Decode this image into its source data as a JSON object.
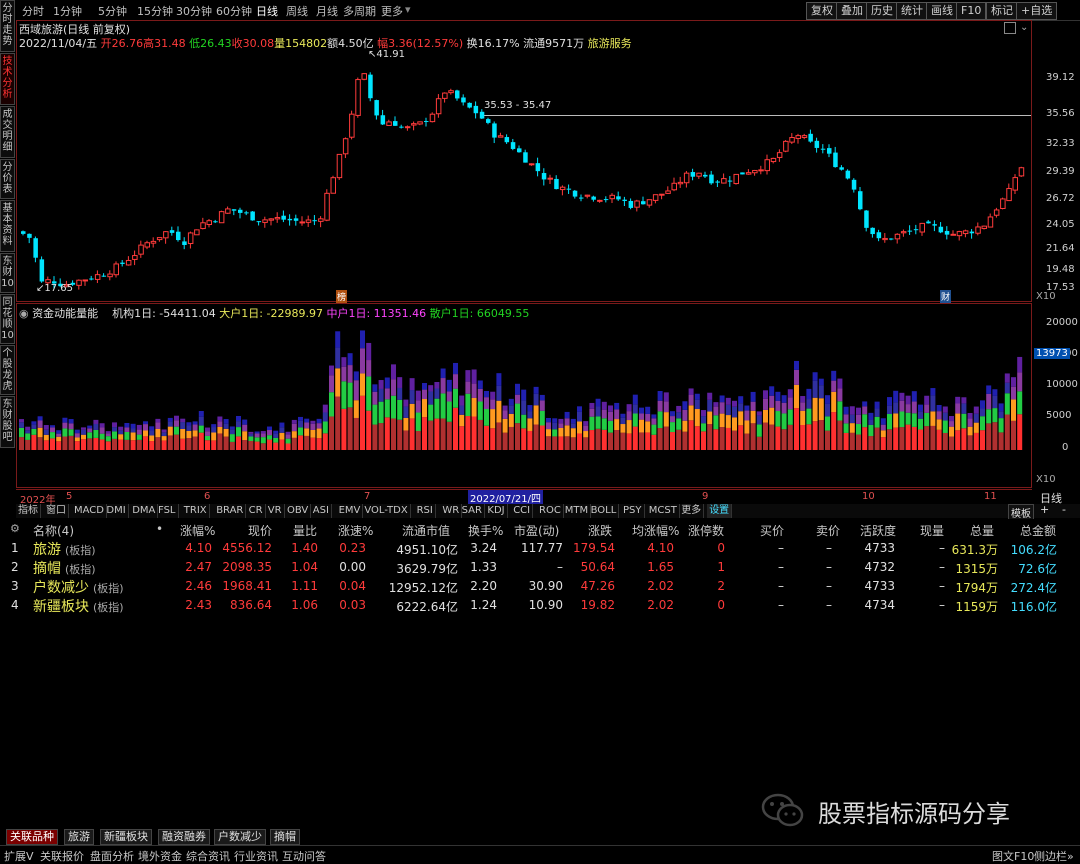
{
  "toolbar": {
    "periods": [
      "分时",
      "1分钟",
      "5分钟",
      "15分钟",
      "30分钟",
      "60分钟",
      "日线",
      "周线",
      "月线",
      "多周期",
      "更多"
    ],
    "active_period": "日线",
    "right_buttons": [
      "复权",
      "叠加",
      "历史",
      "统计",
      "画线",
      "F10",
      "标记",
      "+自选"
    ]
  },
  "left_tabs": [
    "分时走势",
    "技术分析",
    "成交明细",
    "分价表",
    "基本资料",
    "东财10",
    "同花顺10",
    "个股龙虎",
    "东财股吧"
  ],
  "active_left_tab": "技术分析",
  "stock_header": {
    "title": "西域旅游(日线 前复权)",
    "date": "2022/11/04/五",
    "open": "开26.76",
    "high": "高31.48",
    "low": "低26.43",
    "close": "收30.08",
    "volume": "量154802",
    "amount": "额4.50亿",
    "change": "幅3.36(12.57%)",
    "turnover": "换16.17%",
    "float_shares": "流通9571万",
    "industry": "旅游服务"
  },
  "main_chart": {
    "price_labels": [
      "39.12",
      "35.56",
      "32.33",
      "29.39",
      "26.72",
      "24.05",
      "21.64",
      "19.48",
      "17.53"
    ],
    "high_marker": "41.91",
    "low_marker": "17.65",
    "range_label": "35.53 - 35.47",
    "x10_label": "X10",
    "event_label_1": "榜",
    "event_label_2": "财"
  },
  "vol_chart": {
    "title": "资金动能量能",
    "metrics": [
      {
        "label": "机构1日: -54411.04",
        "color": "#e0e0e0"
      },
      {
        "label": "大户1日: -22989.97",
        "color": "#e8e85a"
      },
      {
        "label": "中户1日: 11351.46",
        "color": "#ff44ff"
      },
      {
        "label": "散户1日: 66049.55",
        "color": "#22d322"
      }
    ],
    "axis_labels": [
      "20000",
      "15000",
      "10000",
      "5000",
      "0"
    ],
    "current_value": "13973",
    "x10_label": "X10"
  },
  "date_strip": {
    "labels": [
      "2022年",
      "5",
      "6",
      "7",
      "2022/07/21/四",
      "9",
      "10",
      "11"
    ],
    "right_label": "日线"
  },
  "indicator_tabs": [
    "指标",
    "窗口",
    "MACD",
    "DMI",
    "DMA",
    "FSL",
    "TRIX",
    "BRAR",
    "CR",
    "VR",
    "OBV",
    "ASI",
    "EMV",
    "VOL-TDX",
    "RSI",
    "WR",
    "SAR",
    "KDJ",
    "CCI",
    "ROC",
    "MTM",
    "BOLL",
    "PSY",
    "MCST",
    "更多",
    "设置"
  ],
  "template_button": "模板",
  "table": {
    "headers": [
      "名称(4)",
      "•",
      "涨幅%",
      "现价",
      "量比",
      "涨速%",
      "流通市值",
      "换手%",
      "市盈(动)",
      "涨跌",
      "均涨幅%",
      "涨停数",
      "买价",
      "卖价",
      "活跃度",
      "现量",
      "总量",
      "总金额"
    ],
    "rows": [
      {
        "idx": "1",
        "name": "旅游",
        "tag": "(板指)",
        "chg": "4.10",
        "price": "4556.12",
        "vr": "1.40",
        "spd": "0.23",
        "mcap": "4951.10亿",
        "turn": "3.24",
        "pe": "117.77",
        "diff": "179.54",
        "avg": "4.10",
        "lim": "0",
        "bid": "–",
        "ask": "–",
        "act": "4733",
        "cur": "–",
        "vol": "631.3万",
        "amt": "106.2亿"
      },
      {
        "idx": "2",
        "name": "摘帽",
        "tag": "(板指)",
        "chg": "2.47",
        "price": "2098.35",
        "vr": "1.04",
        "spd": "0.00",
        "mcap": "3629.79亿",
        "turn": "1.33",
        "pe": "–",
        "diff": "50.64",
        "avg": "1.65",
        "lim": "1",
        "bid": "–",
        "ask": "–",
        "act": "4732",
        "cur": "–",
        "vol": "1315万",
        "amt": "72.6亿"
      },
      {
        "idx": "3",
        "name": "户数减少",
        "tag": "(板指)",
        "chg": "2.46",
        "price": "1968.41",
        "vr": "1.11",
        "spd": "0.04",
        "mcap": "12952.12亿",
        "turn": "2.20",
        "pe": "30.90",
        "diff": "47.26",
        "avg": "2.02",
        "lim": "2",
        "bid": "–",
        "ask": "–",
        "act": "4733",
        "cur": "–",
        "vol": "1794万",
        "amt": "272.4亿"
      },
      {
        "idx": "4",
        "name": "新疆板块",
        "tag": "(板指)",
        "chg": "2.43",
        "price": "836.64",
        "vr": "1.06",
        "spd": "0.03",
        "mcap": "6222.64亿",
        "turn": "1.24",
        "pe": "10.90",
        "diff": "19.82",
        "avg": "2.02",
        "lim": "0",
        "bid": "–",
        "ask": "–",
        "act": "4734",
        "cur": "–",
        "vol": "1159万",
        "amt": "116.0亿"
      }
    ]
  },
  "bottom_tabs": [
    "关联品种",
    "旅游",
    "新疆板块",
    "融资融券",
    "户数减少",
    "摘帽"
  ],
  "active_bottom_tab": "关联品种",
  "status_bar": [
    "扩展V",
    "关联报价",
    "盘面分析",
    "境外资金",
    "综合资讯",
    "行业资讯",
    "互动问答"
  ],
  "status_right": [
    "图文F10",
    "侧边栏»"
  ],
  "watermark": "股票指标源码分享",
  "colors": {
    "up": "#ff3b3b",
    "down": "#00e5ff",
    "bg": "#000000",
    "grid": "#7a1a1a"
  }
}
